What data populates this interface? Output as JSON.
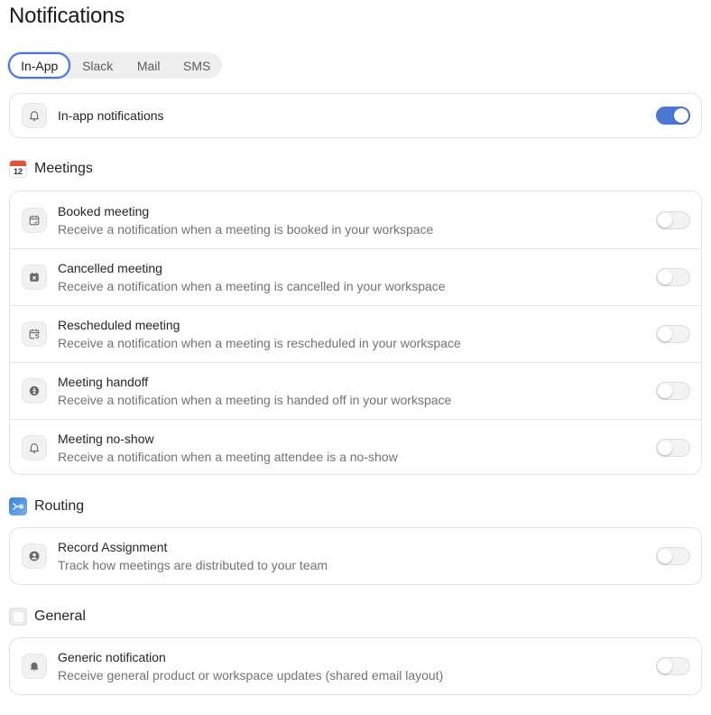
{
  "page": {
    "title": "Notifications"
  },
  "tabs": [
    {
      "label": "In-App",
      "active": true
    },
    {
      "label": "Slack",
      "active": false
    },
    {
      "label": "Mail",
      "active": false
    },
    {
      "label": "SMS",
      "active": false
    }
  ],
  "inapp": {
    "icon": "bell-icon",
    "title": "In-app notifications",
    "enabled": true
  },
  "meetings": {
    "title": "Meetings",
    "icon_text": "12",
    "items": [
      {
        "icon": "calendar-check-icon",
        "title": "Booked meeting",
        "desc": "Receive a notification when a meeting is booked in your workspace",
        "enabled": false
      },
      {
        "icon": "calendar-x-icon",
        "title": "Cancelled meeting",
        "desc": "Receive a notification when a meeting is cancelled in your workspace",
        "enabled": false
      },
      {
        "icon": "calendar-refresh-icon",
        "title": "Rescheduled meeting",
        "desc": "Receive a notification when a meeting is rescheduled in your workspace",
        "enabled": false
      },
      {
        "icon": "handoff-icon",
        "title": "Meeting handoff",
        "desc": "Receive a notification when a meeting is handed off in your workspace",
        "enabled": false
      },
      {
        "icon": "bell-icon",
        "title": "Meeting no-show",
        "desc": "Receive a notification when a meeting attendee is a no-show",
        "enabled": false
      }
    ]
  },
  "routing": {
    "title": "Routing",
    "items": [
      {
        "icon": "user-circle-icon",
        "title": "Record Assignment",
        "desc": "Track how meetings are distributed to your team",
        "enabled": false
      }
    ]
  },
  "general": {
    "title": "General",
    "items": [
      {
        "icon": "bell-filled-icon",
        "title": "Generic notification",
        "desc": "Receive general product or workspace updates (shared email layout)",
        "enabled": false
      }
    ]
  },
  "colors": {
    "accent": "#4a77d6",
    "calendar_red": "#e0533d",
    "routing_blue": "#3b82d6"
  }
}
